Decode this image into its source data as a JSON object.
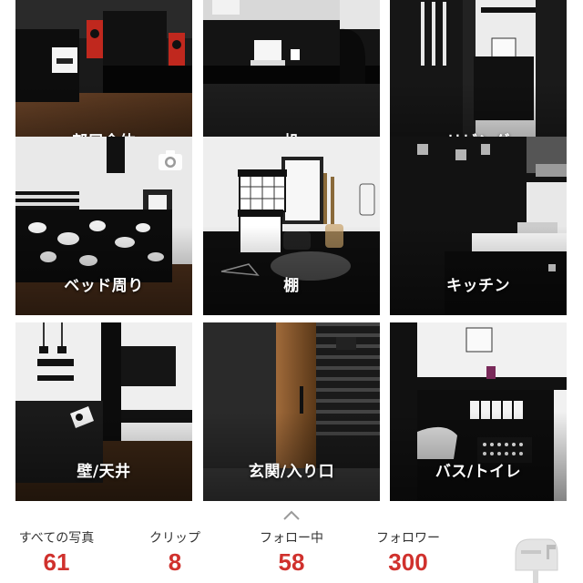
{
  "tiles": [
    {
      "label": "部屋全体"
    },
    {
      "label": "机"
    },
    {
      "label": "リビング"
    },
    {
      "label": "ベッド周り"
    },
    {
      "label": "棚"
    },
    {
      "label": "キッチン"
    },
    {
      "label": "壁/天井"
    },
    {
      "label": "玄関/入り口"
    },
    {
      "label": "バス/トイレ"
    }
  ],
  "stats": [
    {
      "label": "すべての写真",
      "value": "61"
    },
    {
      "label": "クリップ",
      "value": "8"
    },
    {
      "label": "フォロー中",
      "value": "58"
    },
    {
      "label": "フォロワー",
      "value": "300"
    }
  ],
  "icons": {
    "camera": "camera-icon",
    "expand": "chevron-up-icon",
    "mailbox": "mailbox-icon"
  },
  "colors": {
    "stat_value": "#d0312d",
    "stat_label": "#333333",
    "tile_label": "#ffffff"
  }
}
